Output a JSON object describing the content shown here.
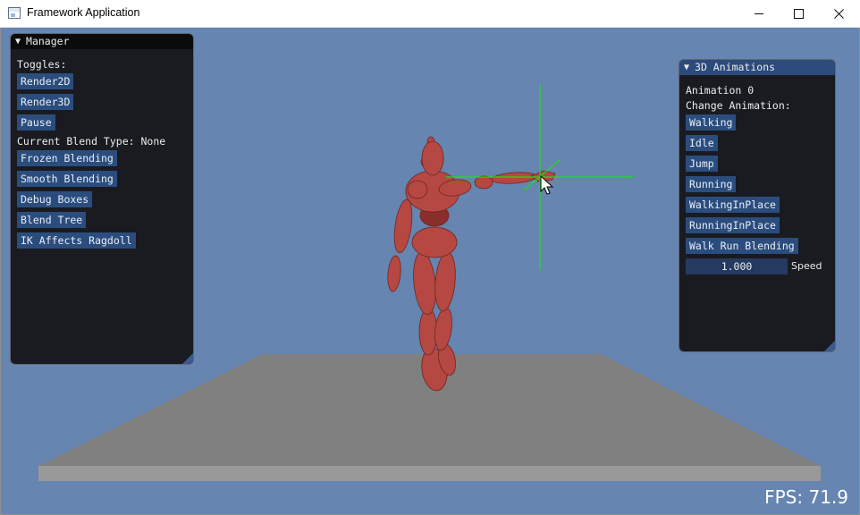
{
  "window": {
    "title": "Framework Application",
    "controls": [
      "minimize-icon",
      "maximize-icon",
      "close-icon"
    ]
  },
  "manager_panel": {
    "title": "Manager",
    "toggles_label": "Toggles:",
    "render2d": "Render2D",
    "render3d": "Render3D",
    "pause": "Pause",
    "blend_type": "Current Blend Type: None",
    "frozen_blending": "Frozen Blending",
    "smooth_blending": "Smooth Blending",
    "debug_boxes": "Debug Boxes",
    "blend_tree": "Blend Tree",
    "ik_affects_ragdoll": "IK Affects Ragdoll"
  },
  "anim_panel": {
    "title": "3D Animations",
    "current": "Animation 0",
    "change_label": "Change Animation:",
    "walking": "Walking",
    "idle": "Idle",
    "jump": "Jump",
    "running": "Running",
    "walking_in_place": "WalkingInPlace",
    "running_in_place": "RunningInPlace",
    "walk_run_blending": "Walk Run Blending",
    "speed_value": "1.000",
    "speed_label": "Speed"
  },
  "status": {
    "fps": "FPS: 71.9"
  },
  "colors": {
    "background": "#6685b0",
    "floor": "#808080",
    "character": "#b54843",
    "ik_target": "#19e01a",
    "button": "#2b4d7e",
    "panel_bg": "#141416"
  }
}
